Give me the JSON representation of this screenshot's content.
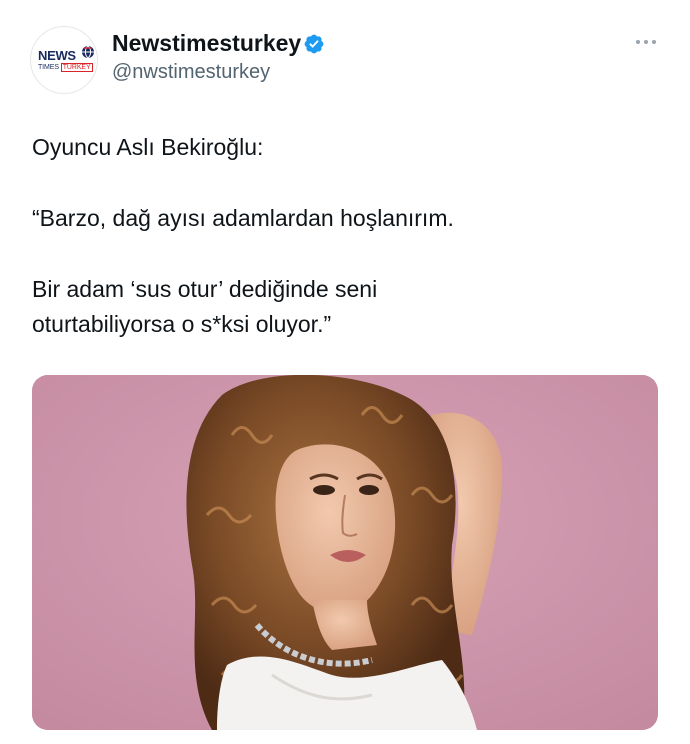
{
  "tweet": {
    "author": {
      "display_name": "Newstimesturkey",
      "handle": "@nwstimesturkey",
      "verified_icon": "verified-badge-icon",
      "avatar_logo_main": "NEWS",
      "avatar_logo_sub_left": "TIMES",
      "avatar_logo_sub_right": "TURKEY"
    },
    "more_icon": "more-options-icon",
    "body": [
      "Oyuncu Aslı Bekiroğlu:",
      "“Barzo, dağ ayısı adamlardan hoşlanırım.",
      "Bir adam ‘sus otur’ dediğinde seni oturtabiliyorsa o s*ksi oluyor.”"
    ],
    "media": {
      "background_color": "#cf97ab"
    }
  },
  "colors": {
    "accent": "#1d9bf0",
    "text_primary": "#0f1419",
    "text_secondary": "#536471"
  }
}
